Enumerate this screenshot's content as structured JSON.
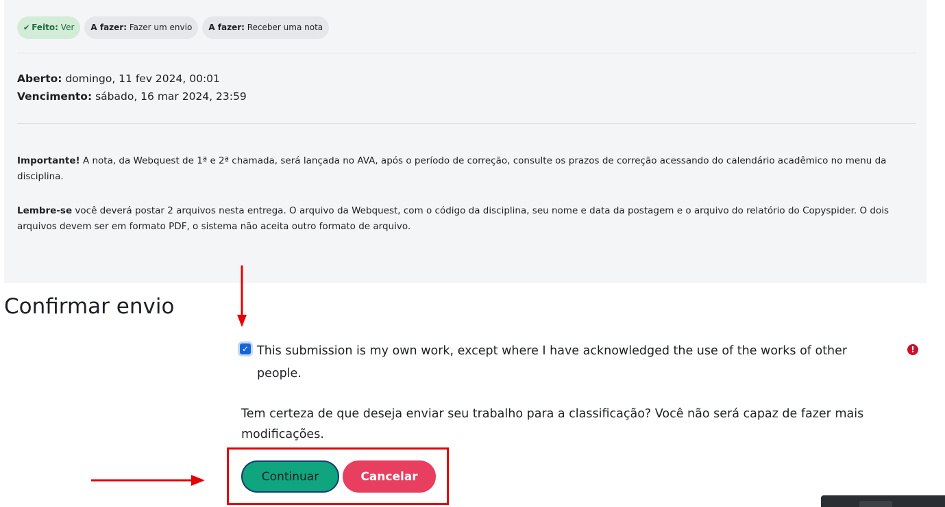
{
  "badges": [
    {
      "prefix": "Feito:",
      "text": "Ver",
      "state": "done"
    },
    {
      "prefix": "A fazer:",
      "text": "Fazer um envio",
      "state": "todo"
    },
    {
      "prefix": "A fazer:",
      "text": "Receber uma nota",
      "state": "todo"
    }
  ],
  "dates": {
    "opened_label": "Aberto:",
    "opened_value": "domingo, 11 fev 2024, 00:01",
    "due_label": "Vencimento:",
    "due_value": "sábado, 16 mar 2024, 23:59"
  },
  "notes": {
    "important_label": "Importante!",
    "important_text": "A nota, da Webquest de 1ª e 2ª chamada, será lançada no AVA, após o período de correção, consulte os prazos de correção acessando do calendário acadêmico no menu da disciplina.",
    "remember_label": "Lembre-se",
    "remember_text": "você deverá postar 2 arquivos nesta entrega. O arquivo da Webquest, com o código da disciplina, seu nome e data da postagem e o arquivo do relatório do Copyspider. O dois arquivos devem ser em formato PDF, o sistema não aceita outro formato de arquivo."
  },
  "confirm": {
    "heading": "Confirmar envio",
    "checkbox_label": "This submission is my own work, except where I have acknowledged the use of the works of other people.",
    "checkbox_checked": true,
    "question": "Tem certeza de que deseja enviar seu trabalho para a classificação? Você não será capaz de fazer mais modificações.",
    "continue_label": "Continuar",
    "cancel_label": "Cancelar"
  },
  "colors": {
    "done_badge": "#d2ecd8",
    "continue_button": "#0fa57f",
    "cancel_button": "#e83e5f",
    "annotation_red": "#e60000"
  },
  "icons": {
    "done_badge": "check-icon",
    "required": "exclamation-circle-icon"
  }
}
